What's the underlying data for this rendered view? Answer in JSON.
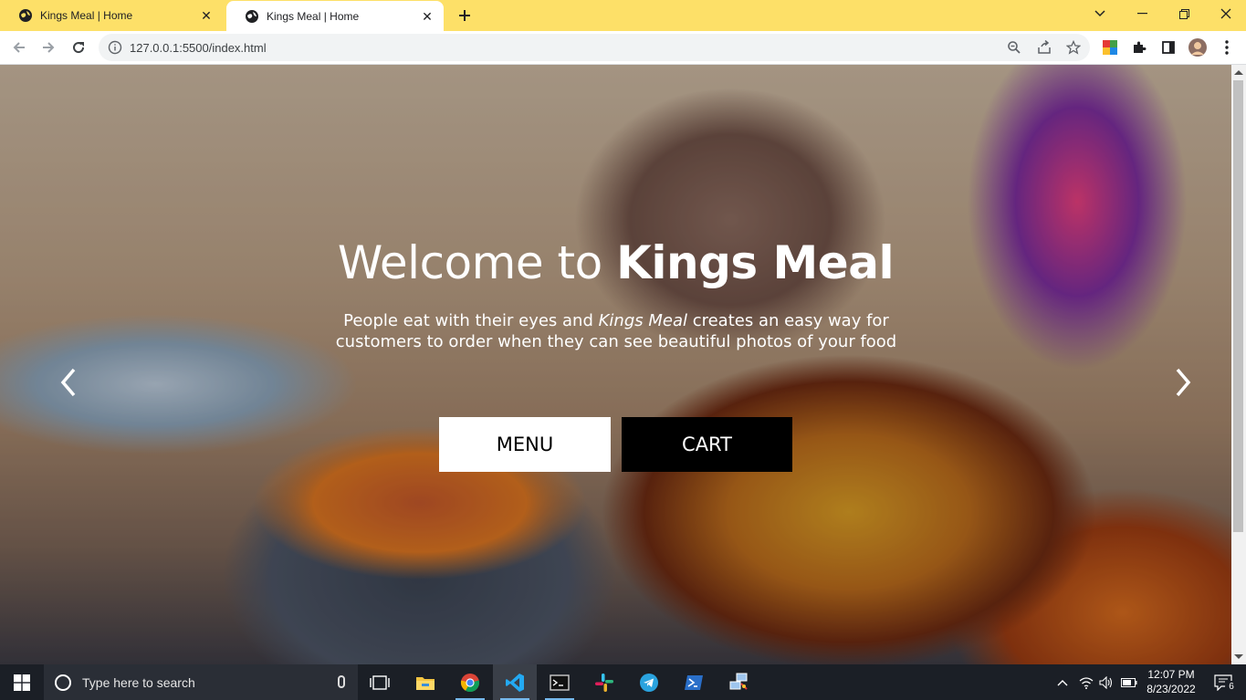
{
  "browser": {
    "tabs": [
      {
        "title": "Kings Meal | Home",
        "active": false
      },
      {
        "title": "Kings Meal | Home",
        "active": true
      }
    ],
    "url": "127.0.0.1:5500/index.html"
  },
  "hero": {
    "title_prefix": "Welcome to ",
    "title_brand": "Kings Meal",
    "text_before": "People eat with their eyes and ",
    "text_brand": "Kings Meal",
    "text_after": " creates an easy way for customers to order when they can see beautiful photos of your food",
    "menu_button": "MENU",
    "cart_button": "CART"
  },
  "taskbar": {
    "search_placeholder": "Type here to search",
    "time": "12:07 PM",
    "date": "8/23/2022",
    "notification_count": "6"
  },
  "colors": {
    "tabstrip": "#fde068",
    "taskbar": "#1b1f26"
  }
}
